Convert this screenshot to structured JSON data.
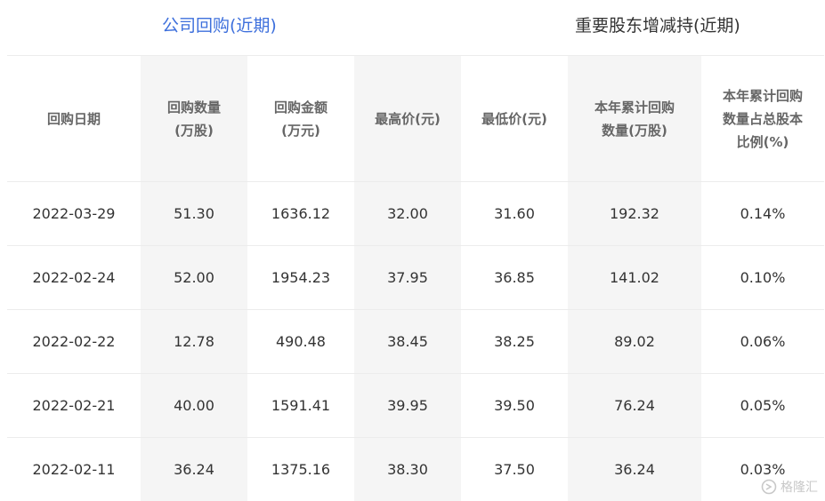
{
  "tabs": {
    "active": "公司回购(近期)",
    "inactive": "重要股东增减持(近期)"
  },
  "table": {
    "headers": [
      [
        "回购日期"
      ],
      [
        "回购数量",
        "(万股)"
      ],
      [
        "回购金额",
        "(万元)"
      ],
      [
        "最高价(元)"
      ],
      [
        "最低价(元)"
      ],
      [
        "本年累计回购",
        "数量(万股)"
      ],
      [
        "本年累计回购",
        "数量占总股本",
        "比例(%)"
      ]
    ],
    "rows": [
      [
        "2022-03-29",
        "51.30",
        "1636.12",
        "32.00",
        "31.60",
        "192.32",
        "0.14%"
      ],
      [
        "2022-02-24",
        "52.00",
        "1954.23",
        "37.95",
        "36.85",
        "141.02",
        "0.10%"
      ],
      [
        "2022-02-22",
        "12.78",
        "490.48",
        "38.45",
        "38.25",
        "89.02",
        "0.06%"
      ],
      [
        "2022-02-21",
        "40.00",
        "1591.41",
        "39.95",
        "39.50",
        "76.24",
        "0.05%"
      ],
      [
        "2022-02-11",
        "36.24",
        "1375.16",
        "38.30",
        "37.50",
        "36.24",
        "0.03%"
      ]
    ]
  },
  "watermark": {
    "text": "格隆汇"
  },
  "colors": {
    "accent": "#3d6fdc",
    "shade": "#f5f5f5",
    "header_text": "#666666"
  }
}
